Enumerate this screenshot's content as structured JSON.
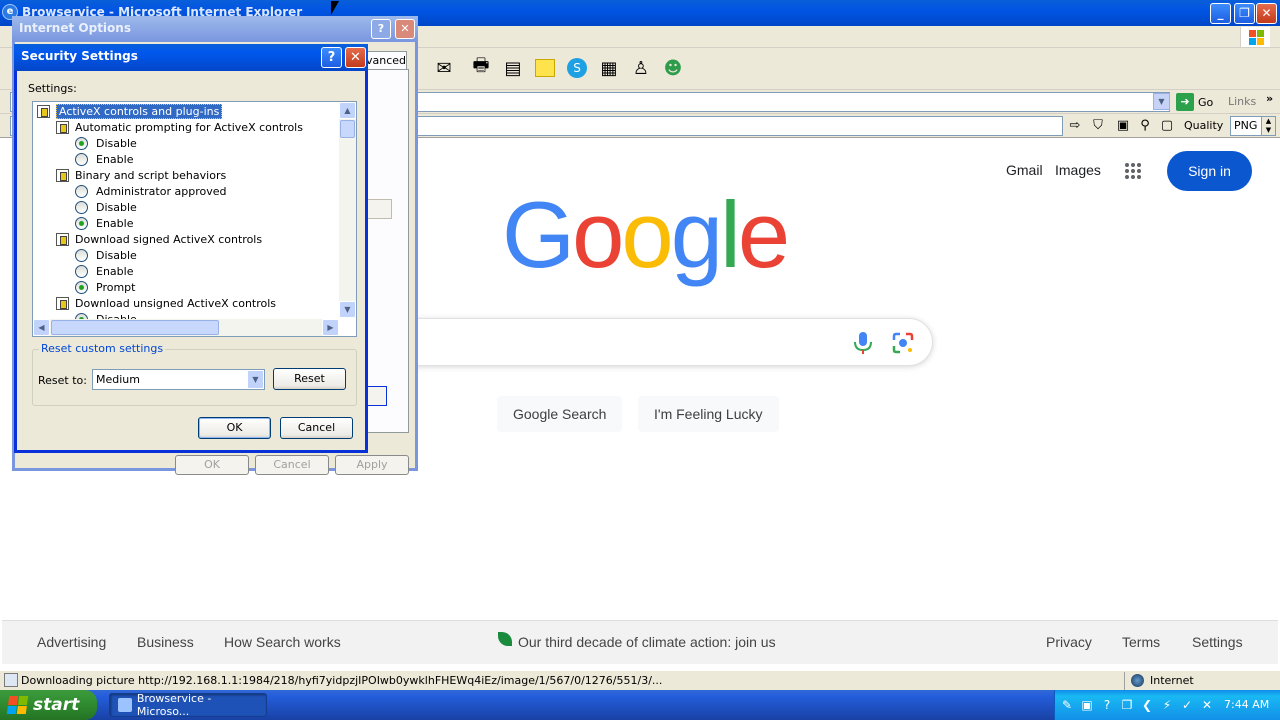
{
  "window": {
    "title": "Browservice - Microsoft Internet Explorer"
  },
  "address_bar": {
    "go_label": "Go",
    "links_label": "Links"
  },
  "plugin_bar": {
    "quality_label": "Quality",
    "format_value": "PNG"
  },
  "google": {
    "gmail": "Gmail",
    "images": "Images",
    "sign_in": "Sign in",
    "logo_letters": [
      {
        "ch": "G",
        "color": "#4285f4"
      },
      {
        "ch": "o",
        "color": "#ea4335"
      },
      {
        "ch": "o",
        "color": "#fbbc05"
      },
      {
        "ch": "g",
        "color": "#4285f4"
      },
      {
        "ch": "l",
        "color": "#34a853"
      },
      {
        "ch": "e",
        "color": "#ea4335"
      }
    ],
    "search_button": "Google Search",
    "lucky_button": "I'm Feeling Lucky",
    "footer": {
      "advertising": "Advertising",
      "business": "Business",
      "how_search_works": "How Search works",
      "climate": "Our third decade of climate action: join us",
      "privacy": "Privacy",
      "terms": "Terms",
      "settings": "Settings"
    }
  },
  "status_bar": {
    "text": "Downloading picture http://192.168.1.1:1984/218/hyfi7yidpzjIPOIwb0ywklhFHEWq4iEz/image/1/567/0/1276/551/3/...",
    "zone": "Internet"
  },
  "taskbar": {
    "start_label": "start",
    "task_label": "Browservice - Microso...",
    "clock": "7:44 AM"
  },
  "internet_options": {
    "title": "Internet Options",
    "tab_label": "vanced",
    "ok_label": "OK",
    "cancel_label": "Cancel",
    "apply_label": "Apply"
  },
  "security_settings": {
    "title": "Security Settings",
    "settings_label": "Settings:",
    "tree": [
      {
        "type": "category",
        "label": "ActiveX controls and plug-ins",
        "level": 0,
        "selected": true
      },
      {
        "type": "setting",
        "label": "Automatic prompting for ActiveX controls",
        "level": 1
      },
      {
        "type": "option",
        "label": "Disable",
        "level": 2,
        "checked": true
      },
      {
        "type": "option",
        "label": "Enable",
        "level": 2,
        "checked": false
      },
      {
        "type": "setting",
        "label": "Binary and script behaviors",
        "level": 1
      },
      {
        "type": "option",
        "label": "Administrator approved",
        "level": 2,
        "checked": false
      },
      {
        "type": "option",
        "label": "Disable",
        "level": 2,
        "checked": false
      },
      {
        "type": "option",
        "label": "Enable",
        "level": 2,
        "checked": true
      },
      {
        "type": "setting",
        "label": "Download signed ActiveX controls",
        "level": 1
      },
      {
        "type": "option",
        "label": "Disable",
        "level": 2,
        "checked": false
      },
      {
        "type": "option",
        "label": "Enable",
        "level": 2,
        "checked": false
      },
      {
        "type": "option",
        "label": "Prompt",
        "level": 2,
        "checked": true
      },
      {
        "type": "setting",
        "label": "Download unsigned ActiveX controls",
        "level": 1
      },
      {
        "type": "option",
        "label": "Disable",
        "level": 2,
        "checked": true
      }
    ],
    "reset_group_title": "Reset custom settings",
    "reset_to_label": "Reset to:",
    "reset_level": "Medium",
    "reset_button": "Reset",
    "ok_button": "OK",
    "cancel_button": "Cancel"
  }
}
